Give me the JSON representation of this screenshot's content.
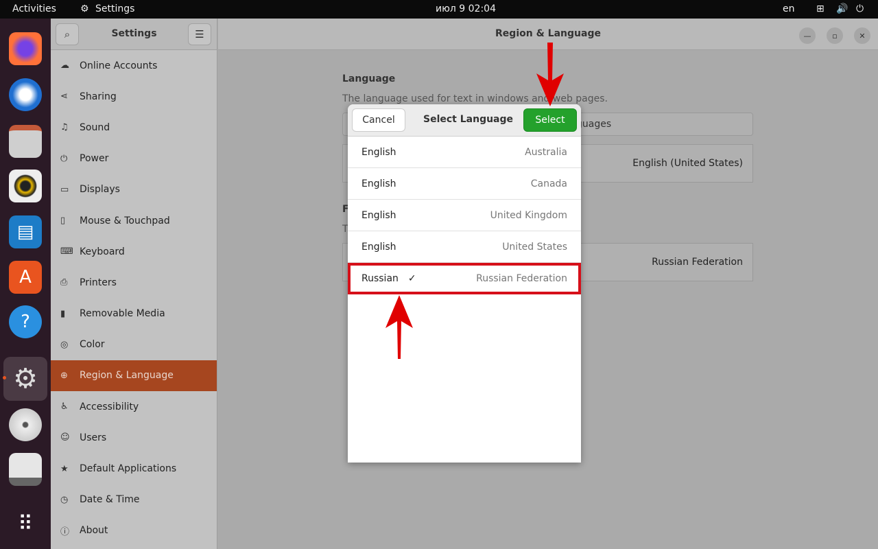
{
  "topbar": {
    "activities": "Activities",
    "app": "Settings",
    "clock": "июл 9  02:04",
    "keyboard_layout": "en"
  },
  "dock": [
    "firefox",
    "thunderbird",
    "files",
    "rhythmbox",
    "libreoffice-writer",
    "ubuntu-software",
    "help",
    "settings",
    "dvd",
    "floppy",
    "show-apps"
  ],
  "sidebar": {
    "title": "Settings",
    "items": [
      {
        "icon": "cloud",
        "label": "Online Accounts"
      },
      {
        "icon": "share",
        "label": "Sharing"
      },
      {
        "icon": "music-note",
        "label": "Sound"
      },
      {
        "icon": "power",
        "label": "Power"
      },
      {
        "icon": "display",
        "label": "Displays"
      },
      {
        "icon": "mouse",
        "label": "Mouse & Touchpad"
      },
      {
        "icon": "keyboard",
        "label": "Keyboard"
      },
      {
        "icon": "printer",
        "label": "Printers"
      },
      {
        "icon": "usb",
        "label": "Removable Media"
      },
      {
        "icon": "color",
        "label": "Color"
      },
      {
        "icon": "globe",
        "label": "Region & Language",
        "active": true
      },
      {
        "icon": "accessibility",
        "label": "Accessibility"
      },
      {
        "icon": "users",
        "label": "Users"
      },
      {
        "icon": "star",
        "label": "Default Applications"
      },
      {
        "icon": "clock",
        "label": "Date & Time"
      },
      {
        "icon": "info",
        "label": "About"
      }
    ]
  },
  "main": {
    "title": "Region & Language",
    "language_heading": "Language",
    "language_desc": "The language used for text in windows and web pages.",
    "manage_fragment": "guages",
    "language_value": "English (United States)",
    "formats_heading_fragment": "F",
    "formats_desc_fragment": "T",
    "formats_value": "Russian Federation"
  },
  "dialog": {
    "title": "Select Language",
    "cancel": "Cancel",
    "select": "Select",
    "rows": [
      {
        "language": "English",
        "country": "Australia"
      },
      {
        "language": "English",
        "country": "Canada"
      },
      {
        "language": "English",
        "country": "United Kingdom"
      },
      {
        "language": "English",
        "country": "United States"
      },
      {
        "language": "Russian",
        "country": "Russian Federation",
        "selected": true,
        "check": "✓"
      }
    ]
  },
  "colors": {
    "accent": "#a6461f",
    "select_button": "#24a12c",
    "highlight": "#d6101a"
  }
}
